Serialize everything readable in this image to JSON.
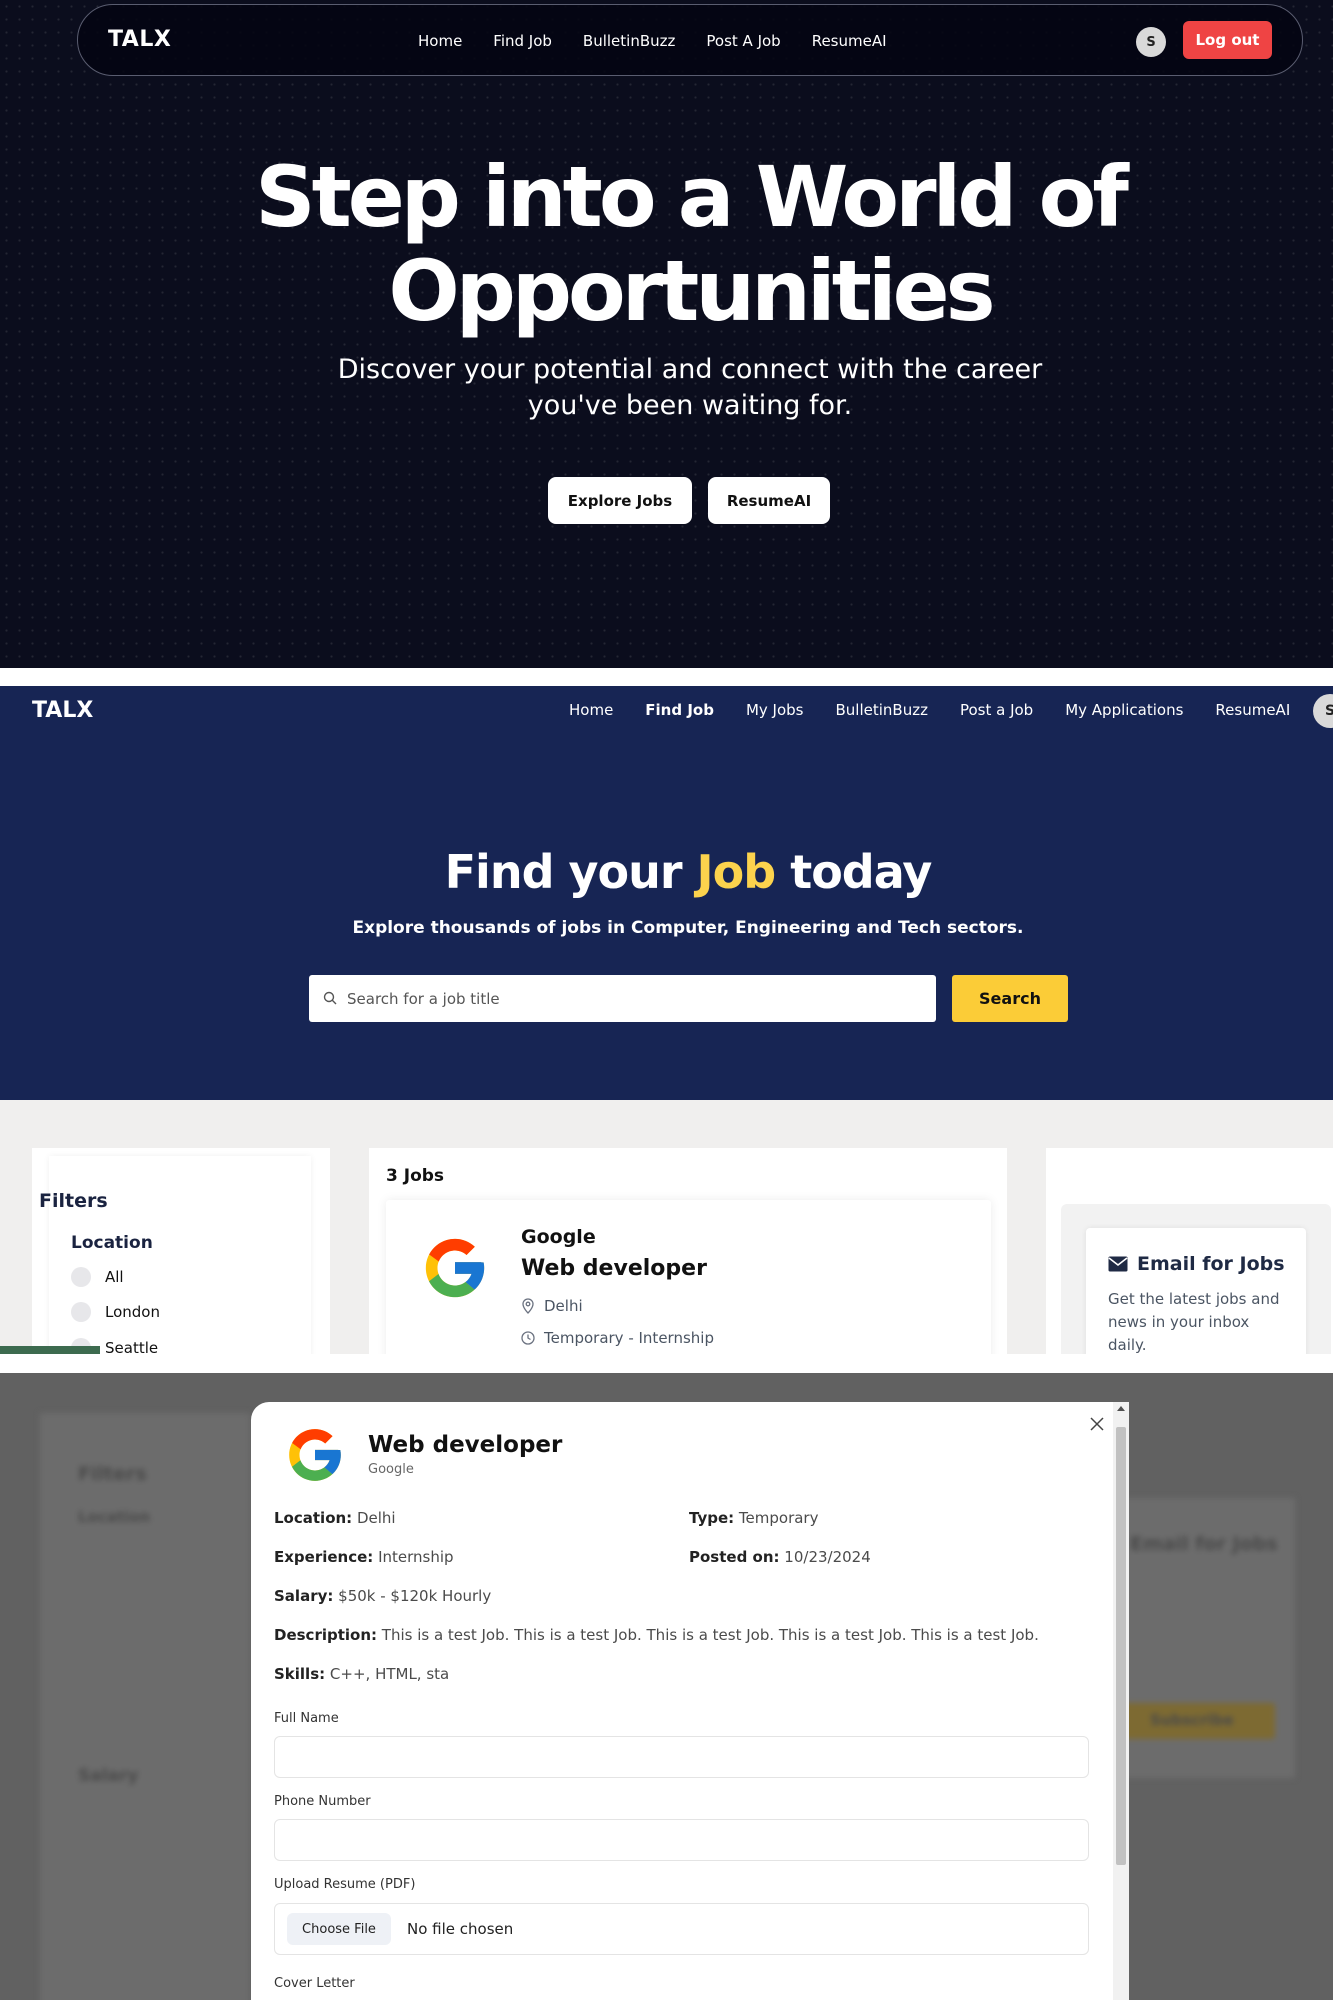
{
  "screen1": {
    "logo": "TALX",
    "nav": [
      "Home",
      "Find Job",
      "BulletinBuzz",
      "Post A Job",
      "ResumeAI"
    ],
    "avatar": "S",
    "logout": "Log out",
    "hero_title_line1": "Step into a World of",
    "hero_title_line2": "Opportunities",
    "hero_sub_line1": "Discover your potential and connect with the career",
    "hero_sub_line2": "you've been waiting for.",
    "btn_explore": "Explore Jobs",
    "btn_resume": "ResumeAI",
    "colors": {
      "bg": "#0b0d1d",
      "logout": "#ef4444"
    }
  },
  "screen2": {
    "logo": "TALX",
    "nav": [
      "Home",
      "Find Job",
      "My Jobs",
      "BulletinBuzz",
      "Post a Job",
      "My Applications",
      "ResumeAI"
    ],
    "active_nav": "Find Job",
    "avatar": "S",
    "title_pre": "Find your ",
    "title_highlight": "Job",
    "title_post": " today",
    "subtitle": "Explore thousands of jobs in Computer, Engineering and Tech sectors.",
    "search": {
      "placeholder": "Search for a job title",
      "value": "",
      "button": "Search",
      "icon": "search-icon"
    },
    "filters": {
      "title": "Filters",
      "location_label": "Location",
      "locations": [
        "All",
        "London",
        "Seattle"
      ]
    },
    "jobs_count": "3 Jobs",
    "job_card": {
      "company": "Google",
      "title": "Web developer",
      "location": "Delhi",
      "type": "Temporary - Internship",
      "logo_icon": "google-logo-icon"
    },
    "email_box": {
      "title": "Email for Jobs",
      "text_line1": "Get the latest jobs and",
      "text_line2": "news in your inbox",
      "text_line3": "daily.",
      "icon": "envelope-icon"
    },
    "colors": {
      "hero_bg": "#172554",
      "accent": "#fcd34d",
      "search_btn": "#fbcc37"
    }
  },
  "screen3": {
    "background": {
      "filters_title": "Filters",
      "location_label": "Location",
      "salary_label": "Salary",
      "email_title": "Email for Jobs",
      "subscribe": "Subscribe"
    },
    "modal": {
      "title": "Web developer",
      "company": "Google",
      "location_label": "Location:",
      "location": "Delhi",
      "type_label": "Type:",
      "type": "Temporary",
      "experience_label": "Experience:",
      "experience": "Internship",
      "posted_label": "Posted on:",
      "posted": "10/23/2024",
      "salary_label": "Salary:",
      "salary": "$50k - $120k Hourly",
      "description_label": "Description:",
      "description": "This is a test Job. This is a test Job. This is a test Job. This is a test Job. This is a test Job.",
      "skills_label": "Skills:",
      "skills": "C++, HTML, sta",
      "full_name_label": "Full Name",
      "full_name_value": "",
      "phone_label": "Phone Number",
      "phone_value": "",
      "resume_label": "Upload Resume (PDF)",
      "choose_file": "Choose File",
      "no_file": "No file chosen",
      "cover_letter_label": "Cover Letter"
    }
  }
}
